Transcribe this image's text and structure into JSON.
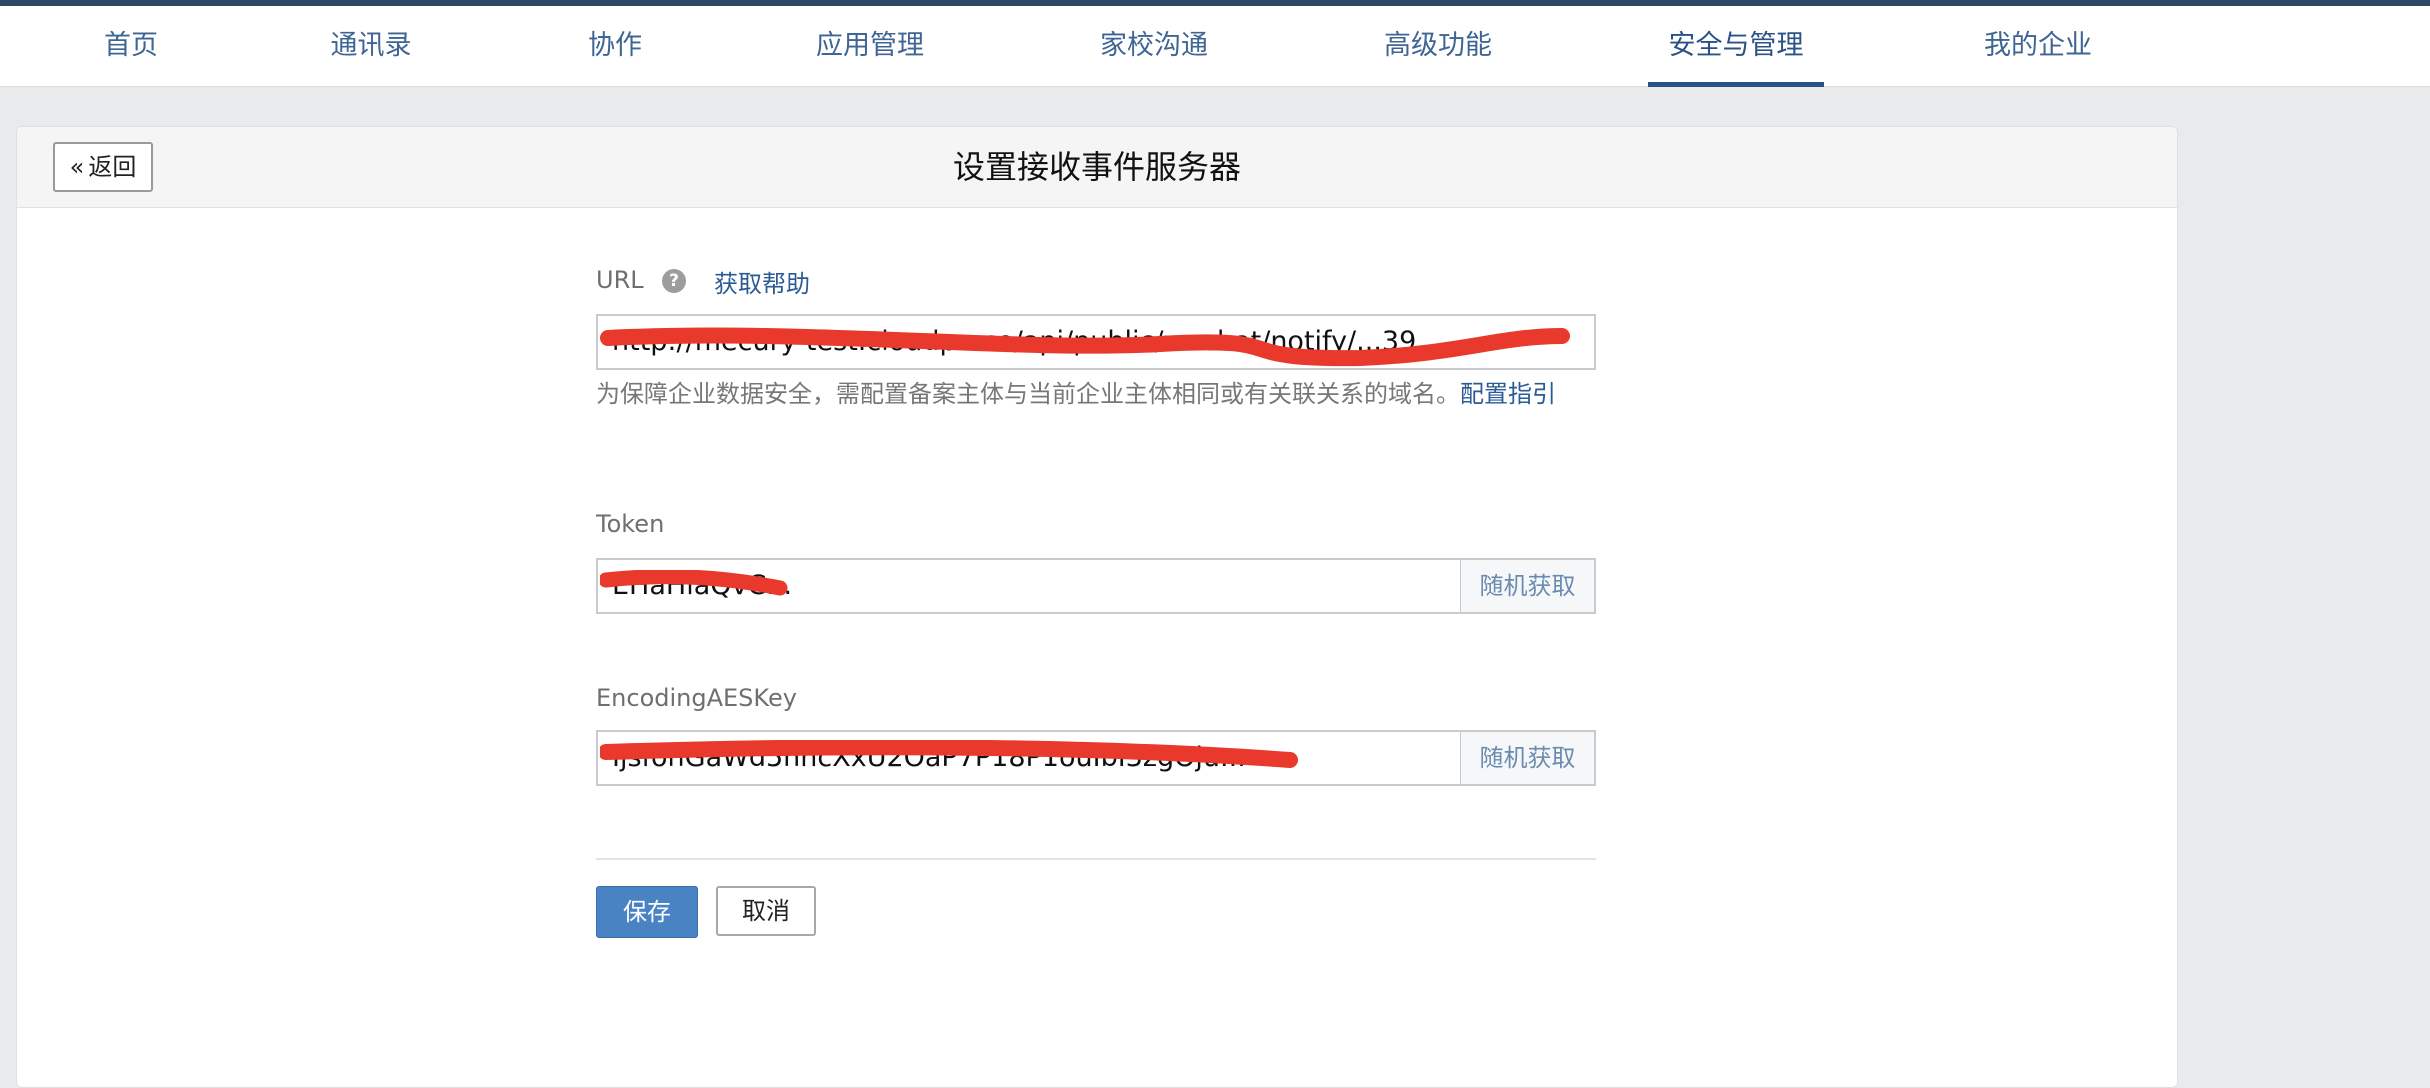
{
  "nav": {
    "items": [
      {
        "label": "首页"
      },
      {
        "label": "通讯录"
      },
      {
        "label": "协作"
      },
      {
        "label": "应用管理"
      },
      {
        "label": "家校沟通"
      },
      {
        "label": "高级功能"
      },
      {
        "label": "安全与管理"
      },
      {
        "label": "我的企业"
      }
    ],
    "active": "安全与管理"
  },
  "header": {
    "back_label": "返回",
    "title": "设置接收事件服务器"
  },
  "form": {
    "url": {
      "label": "URL",
      "help_link": "获取帮助",
      "value": "http://mecury-test.cloudp...co/api/public/wechat/notify/...39",
      "note": "为保障企业数据安全，需配置备案主体与当前企业主体相同或有关联关系的域名。",
      "note_link": "配置指引"
    },
    "token": {
      "label": "Token",
      "value": "EHaHiaQvC...",
      "random_label": "随机获取"
    },
    "aes": {
      "label": "EncodingAESKey",
      "value": "IjsfohGaWd5hncXxU2OaP7P18P1ouIbI3zgOju...",
      "random_label": "随机获取"
    },
    "save_label": "保存",
    "cancel_label": "取消"
  },
  "colors": {
    "nav_text": "#3e6593",
    "active_underline": "#2a5286",
    "primary_button": "#4a83c4",
    "redaction": "#e8392c"
  }
}
